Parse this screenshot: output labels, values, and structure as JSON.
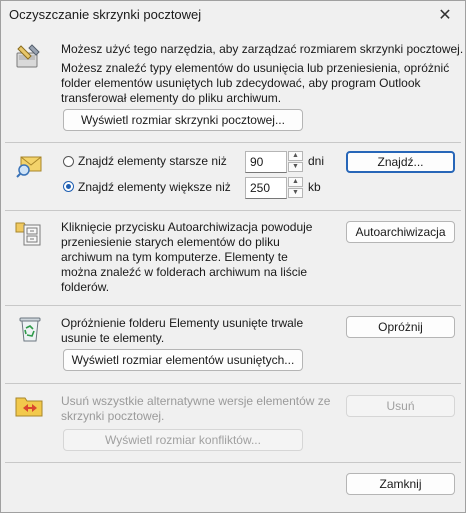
{
  "window": {
    "title": "Oczyszczanie skrzynki pocztowej"
  },
  "section_manage": {
    "text1": "Możesz użyć tego narzędzia, aby zarządzać rozmiarem skrzynki pocztowej.",
    "text2_lines": [
      "Możesz znaleźć typy elementów do usunięcia lub przeniesienia, opróżnić",
      "folder elementów usuniętych lub zdecydować, aby program Outlook",
      "transferował elementy do pliku archiwum."
    ],
    "button_label": "Wyświetl rozmiar skrzynki pocztowej..."
  },
  "section_find": {
    "older_label": "Znajdź elementy starsze niż",
    "older_value": "90",
    "older_unit": "dni",
    "larger_label": "Znajdź elementy większe niż",
    "larger_value": "250",
    "larger_unit": "kb",
    "selected": "larger",
    "find_button": "Znajdź..."
  },
  "section_archive": {
    "text_lines": [
      "Kliknięcie przycisku Autoarchiwizacja powoduje",
      "przeniesienie starych elementów do pliku",
      "archiwum na tym komputerze. Elementy te",
      "można znaleźć w folderach archiwum na liście",
      "folderów."
    ],
    "button_label": "Autoarchiwizacja"
  },
  "section_deleted": {
    "text_lines": [
      "Opróżnienie folderu Elementy usunięte trwale",
      "usunie te elementy."
    ],
    "empty_button": "Opróżnij",
    "view_button": "Wyświetl rozmiar elementów usuniętych..."
  },
  "section_conflicts": {
    "text_lines": [
      "Usuń wszystkie alternatywne wersje elementów ze",
      "skrzynki pocztowej."
    ],
    "delete_button": "Usuń",
    "view_button": "Wyświetl rozmiar konfliktów..."
  },
  "footer": {
    "close_button": "Zamknij"
  }
}
